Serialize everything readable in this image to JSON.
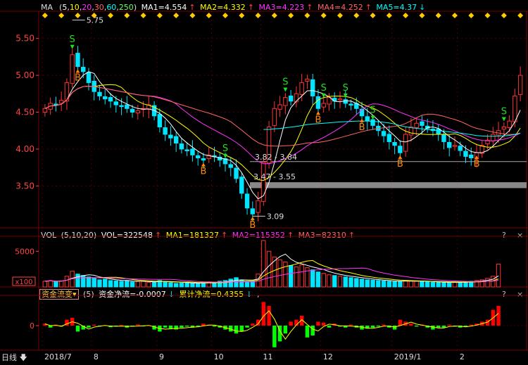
{
  "colors": {
    "bg": "#000000",
    "grid": "#7a0000",
    "up": "#ff3333",
    "down": "#00e5ff",
    "ma1": "#ffffff",
    "ma2": "#ffff00",
    "ma3": "#ff33ff",
    "ma4": "#ff6666",
    "ma5": "#00ffff",
    "netpos": "#ff0000",
    "netneg": "#00ff00",
    "cum": "#ffff00",
    "axis": "#ff4444",
    "signal_b": "#ff8800",
    "signal_s": "#22dd22",
    "band": "#888888"
  },
  "header": {
    "ma": {
      "label": "MA",
      "params": "(5,10,20,30,60,250)",
      "params_parts": [
        "5",
        "10",
        "20",
        "30",
        "60",
        "250"
      ],
      "ma1": "MA1=4.554",
      "ma2": "MA2=4.332",
      "ma3": "MA3=4.223",
      "ma4": "MA4=4.252",
      "ma5": "MA5=4.37"
    },
    "vol": {
      "label": "VOL",
      "params": "(5,10,20)",
      "vol": "VOL=322548",
      "ma1": "MA1=181327",
      "ma2": "MA2=115352",
      "ma3": "MA3=82310"
    },
    "fund": {
      "label": "资金流变",
      "params": "(5)",
      "net": "资金净流=-0.0007",
      "cum": "累计净流=0.4355",
      "tail": ","
    }
  },
  "help_mark": "?",
  "close_mark": "×",
  "period_button": "日线",
  "x_labels": [
    "2018/7",
    "8",
    "9",
    "10",
    "11",
    "12",
    "2019/1",
    "2"
  ],
  "price_axis": {
    "labels": [
      "5.50",
      "5.00",
      "4.50",
      "4.00",
      "3.50"
    ],
    "values": [
      5.5,
      5.0,
      4.5,
      4.0,
      3.5
    ],
    "ymin": 2.95,
    "ymax": 5.85
  },
  "vol_axis": {
    "labels": [
      "5000"
    ],
    "unit": "x100",
    "ymax": 6700
  },
  "fund_axis": {
    "labels": [
      "0"
    ]
  },
  "annotations": {
    "high": "5.75",
    "low": "3.09",
    "range1": "3.82 - 3.84",
    "range2": "3.47 - 3.55"
  },
  "signals": [
    {
      "text": "B",
      "kind": "buy",
      "index": 6
    },
    {
      "text": "S",
      "kind": "sell",
      "index": 5
    },
    {
      "text": "B",
      "kind": "buy",
      "index": 29
    },
    {
      "text": "S",
      "kind": "sell",
      "index": 33
    },
    {
      "text": "B",
      "kind": "buy",
      "index": 38
    },
    {
      "text": "S",
      "kind": "sell",
      "index": 44
    },
    {
      "text": "S",
      "kind": "sell",
      "index": 51
    },
    {
      "text": "B",
      "kind": "buy",
      "index": 50
    },
    {
      "text": "S",
      "kind": "sell",
      "index": 55
    },
    {
      "text": "B",
      "kind": "buy",
      "index": 58
    },
    {
      "text": "S",
      "kind": "sell",
      "index": 60
    },
    {
      "text": "B",
      "kind": "buy",
      "index": 65
    },
    {
      "text": "B",
      "kind": "buy",
      "index": 79
    },
    {
      "text": "S",
      "kind": "sell",
      "index": 84
    },
    {
      "text": "B",
      "kind": "buy",
      "index": 97
    }
  ],
  "chart_data": {
    "type": "candlestick",
    "period": "daily",
    "closes": [
      4.55,
      4.62,
      4.6,
      4.66,
      4.9,
      5.28,
      5.12,
      5.05,
      4.9,
      4.78,
      4.72,
      4.68,
      4.65,
      4.6,
      4.58,
      4.55,
      4.5,
      4.52,
      4.55,
      4.6,
      4.45,
      4.3,
      4.2,
      4.15,
      4.08,
      4.0,
      3.98,
      3.92,
      3.88,
      3.85,
      3.92,
      3.9,
      3.85,
      3.8,
      3.75,
      3.6,
      3.4,
      3.2,
      3.12,
      3.3,
      3.82,
      4.3,
      4.55,
      4.6,
      4.7,
      4.65,
      4.75,
      4.9,
      4.95,
      4.72,
      4.55,
      4.62,
      4.7,
      4.65,
      4.68,
      4.62,
      4.6,
      4.55,
      4.45,
      4.38,
      4.32,
      4.25,
      4.18,
      4.1,
      4.05,
      3.95,
      4.2,
      4.3,
      4.35,
      4.32,
      4.28,
      4.25,
      4.2,
      4.1,
      4.02,
      4.05,
      3.98,
      3.9,
      3.88,
      3.95,
      4.05,
      4.12,
      4.2,
      4.25,
      4.3,
      4.38,
      4.72,
      5.0
    ],
    "volume": [
      800,
      900,
      700,
      850,
      1500,
      2200,
      1800,
      1600,
      1400,
      1200,
      1000,
      1100,
      900,
      850,
      800,
      900,
      700,
      750,
      800,
      650,
      700,
      900,
      750,
      600,
      500,
      550,
      650,
      500,
      450,
      600,
      700,
      600,
      800,
      900,
      1100,
      1300,
      900,
      700,
      800,
      1800,
      6500,
      5000,
      4200,
      3800,
      3500,
      3000,
      2800,
      3100,
      2700,
      2400,
      2100,
      1900,
      1700,
      1600,
      1500,
      1400,
      1300,
      1200,
      1100,
      1000,
      950,
      900,
      850,
      800,
      750,
      800,
      900,
      850,
      800,
      750,
      700,
      650,
      700,
      600,
      550,
      650,
      700,
      750,
      800,
      900,
      1000,
      1200,
      1500,
      3200
    ],
    "fund_net": [
      0.1,
      -0.1,
      0.05,
      -0.05,
      0.3,
      0.4,
      -0.3,
      -0.2,
      -0.1,
      0.05,
      -0.05,
      0.02,
      -0.08,
      -0.05,
      0.03,
      -0.1,
      -0.05,
      0.06,
      -0.04,
      0.02,
      -0.2,
      -0.3,
      -0.1,
      -0.15,
      -0.2,
      -0.1,
      -0.05,
      -0.1,
      -0.05,
      0.1,
      0.05,
      -0.05,
      -0.1,
      -0.2,
      -0.3,
      -0.4,
      -0.3,
      -0.1,
      0.1,
      0.3,
      1.2,
      1.0,
      -1.1,
      -0.8,
      -0.4,
      0.2,
      0.3,
      0.5,
      -0.6,
      -0.5,
      0.2,
      0.15,
      -0.1,
      0.1,
      -0.05,
      -0.1,
      0.05,
      -0.1,
      -0.2,
      -0.15,
      -0.1,
      -0.05,
      0.05,
      -0.1,
      -0.2,
      0.3,
      0.2,
      0.1,
      -0.05,
      0.05,
      -0.1,
      -0.2,
      -0.1,
      -0.1,
      0.05,
      -0.05,
      -0.1,
      -0.05,
      0.05,
      0.1,
      0.2,
      0.3,
      0.8,
      1.0
    ],
    "x_tick_labels": [
      "2018/7",
      "8",
      "9",
      "10",
      "11",
      "12",
      "2019/1",
      "2"
    ],
    "x_tick_index": [
      0,
      9,
      21,
      31,
      40,
      51,
      64,
      76
    ],
    "ma": {
      "MA1": 4.554,
      "MA2": 4.332,
      "MA3": 4.223,
      "MA4": 4.252,
      "MA5": 4.37
    },
    "vol_ma": {
      "VOL": 322548,
      "MA1": 181327,
      "MA2": 115352,
      "MA3": 82310
    },
    "fund": {
      "net": -0.0007,
      "cum": 0.4355
    },
    "price_high": 5.75,
    "price_low": 3.09,
    "ylim": [
      2.95,
      5.85
    ]
  }
}
